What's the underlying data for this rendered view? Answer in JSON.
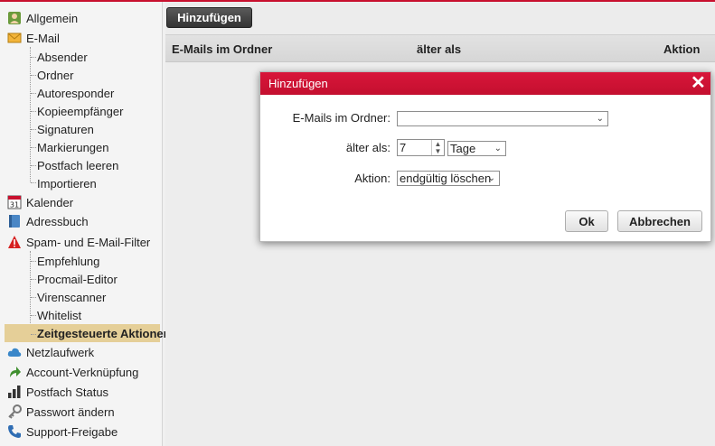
{
  "colors": {
    "accent": "#c8102e",
    "active_bg": "#e5cf98"
  },
  "sidebar": {
    "items": [
      {
        "label": "Allgemein",
        "icon": "user-icon"
      },
      {
        "label": "E-Mail",
        "icon": "envelope-icon"
      },
      {
        "label": "Absender"
      },
      {
        "label": "Ordner"
      },
      {
        "label": "Autoresponder"
      },
      {
        "label": "Kopieempfänger"
      },
      {
        "label": "Signaturen"
      },
      {
        "label": "Markierungen"
      },
      {
        "label": "Postfach leeren"
      },
      {
        "label": "Importieren"
      },
      {
        "label": "Kalender",
        "icon": "calendar-icon",
        "icon_text": "31"
      },
      {
        "label": "Adressbuch",
        "icon": "address-book-icon"
      },
      {
        "label": "Spam- und E-Mail-Filter",
        "icon": "warning-icon"
      },
      {
        "label": "Empfehlung"
      },
      {
        "label": "Procmail-Editor"
      },
      {
        "label": "Virenscanner"
      },
      {
        "label": "Whitelist"
      },
      {
        "label": "Zeitgesteuerte Aktionen",
        "active": true
      },
      {
        "label": "Netzlaufwerk",
        "icon": "cloud-icon"
      },
      {
        "label": "Account-Verknüpfung",
        "icon": "link-arrow-icon"
      },
      {
        "label": "Postfach Status",
        "icon": "bar-chart-icon"
      },
      {
        "label": "Passwort ändern",
        "icon": "key-icon"
      },
      {
        "label": "Support-Freigabe",
        "icon": "phone-icon"
      }
    ]
  },
  "toolbar": {
    "add_label": "Hinzufügen"
  },
  "table": {
    "columns": [
      "E-Mails im Ordner",
      "älter als",
      "Aktion"
    ]
  },
  "dialog": {
    "title": "Hinzufügen",
    "close_icon": "close-icon",
    "folder_label": "E-Mails im Ordner:",
    "folder_value": "",
    "age_label": "älter als:",
    "age_value": "7",
    "age_unit": "Tage",
    "action_label": "Aktion:",
    "action_value": "endgültig löschen",
    "ok_label": "Ok",
    "cancel_label": "Abbrechen"
  }
}
